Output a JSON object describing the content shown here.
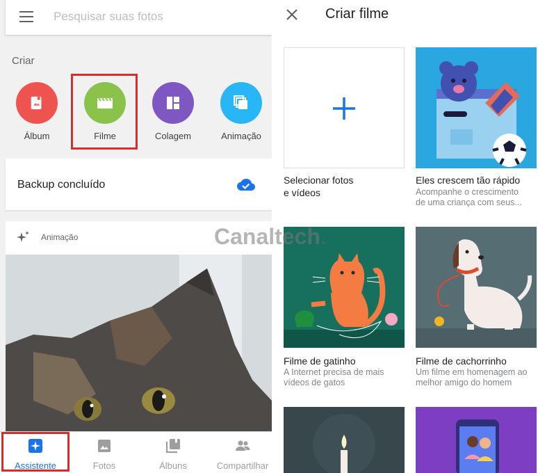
{
  "left": {
    "search_placeholder": "Pesquisar suas fotos",
    "create_section": "Criar",
    "create_items": [
      {
        "label": "Álbum",
        "color": "#ef5350",
        "icon": "album-icon"
      },
      {
        "label": "Filme",
        "color": "#8bc34a",
        "icon": "movie-icon"
      },
      {
        "label": "Colagem",
        "color": "#7e57c2",
        "icon": "collage-icon"
      },
      {
        "label": "Animação",
        "color": "#29b6f6",
        "icon": "animation-icon"
      }
    ],
    "backup_text": "Backup concluído",
    "animation_card_label": "Animação",
    "nav": [
      {
        "label": "Assistente",
        "icon": "assistant-icon",
        "active": true
      },
      {
        "label": "Fotos",
        "icon": "photo-icon"
      },
      {
        "label": "Álbuns",
        "icon": "albums-icon"
      },
      {
        "label": "Compartilhar",
        "icon": "share-icon"
      }
    ]
  },
  "right": {
    "title": "Criar filme",
    "tiles": [
      {
        "title_line1": "Selecionar fotos",
        "title_line2": "e vídeos",
        "subtitle_line1": "",
        "subtitle_line2": ""
      },
      {
        "title_line1": "Eles crescem tão rápido",
        "title_line2": "",
        "subtitle_line1": "Acompanhe o crescimento",
        "subtitle_line2": "de uma criança com seus..."
      },
      {
        "title_line1": "Filme de gatinho",
        "title_line2": "",
        "subtitle_line1": "A Internet precisa de mais",
        "subtitle_line2": "vídeos de gatos"
      },
      {
        "title_line1": "Filme de cachorrinho",
        "title_line2": "",
        "subtitle_line1": "Um filme em homenagem ao",
        "subtitle_line2": "melhor amigo do homem"
      }
    ]
  },
  "watermark": {
    "brand": "Canaltech",
    "dot": "."
  },
  "colors": {
    "accent": "#1a73e8",
    "highlight": "#d32f2f"
  }
}
